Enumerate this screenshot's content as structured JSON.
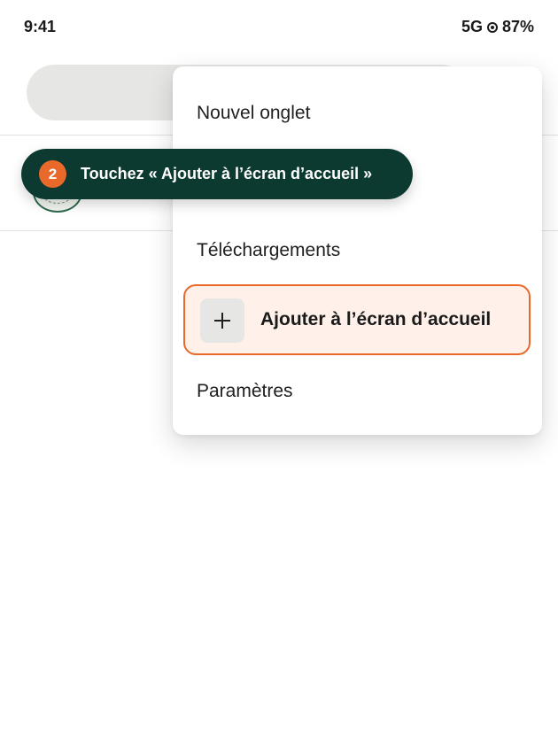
{
  "status_bar": {
    "time": "9:41",
    "network": "5G",
    "signal_icon": "circle-dot-icon",
    "battery": "87%"
  },
  "menu": {
    "items": [
      {
        "label": "Nouvel onglet"
      },
      {
        "label": "Téléchargements"
      },
      {
        "label": "Ajouter à l’écran d’accueil",
        "icon": "plus-icon",
        "highlighted": true
      },
      {
        "label": "Paramètres"
      }
    ]
  },
  "tooltip": {
    "step": "2",
    "text": "Touchez « Ajouter à l’écran d’accueil »"
  },
  "colors": {
    "accent": "#e8692a",
    "tooltip_bg": "#0c3a30",
    "highlight_bg": "#fff1ea",
    "url_bar_bg": "#e6e7e5"
  }
}
